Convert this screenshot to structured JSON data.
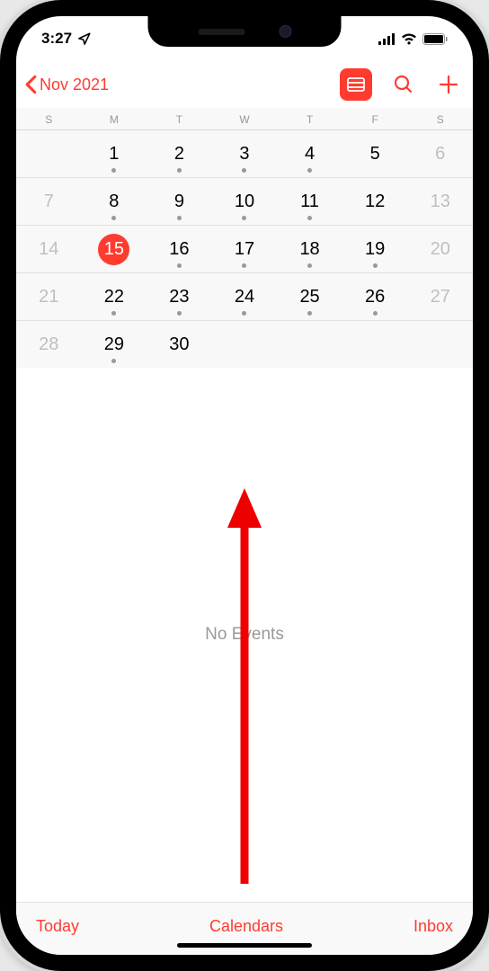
{
  "status_bar": {
    "time": "3:27"
  },
  "nav": {
    "back_label": "Nov 2021"
  },
  "weekdays": [
    "S",
    "M",
    "T",
    "W",
    "T",
    "F",
    "S"
  ],
  "calendar": {
    "weeks": [
      [
        {
          "label": "",
          "muted": false,
          "dot": false,
          "selected": false
        },
        {
          "label": "1",
          "muted": false,
          "dot": true,
          "selected": false
        },
        {
          "label": "2",
          "muted": false,
          "dot": true,
          "selected": false
        },
        {
          "label": "3",
          "muted": false,
          "dot": true,
          "selected": false
        },
        {
          "label": "4",
          "muted": false,
          "dot": true,
          "selected": false
        },
        {
          "label": "5",
          "muted": false,
          "dot": false,
          "selected": false
        },
        {
          "label": "6",
          "muted": true,
          "dot": false,
          "selected": false
        }
      ],
      [
        {
          "label": "7",
          "muted": true,
          "dot": false,
          "selected": false
        },
        {
          "label": "8",
          "muted": false,
          "dot": true,
          "selected": false
        },
        {
          "label": "9",
          "muted": false,
          "dot": true,
          "selected": false
        },
        {
          "label": "10",
          "muted": false,
          "dot": true,
          "selected": false
        },
        {
          "label": "11",
          "muted": false,
          "dot": true,
          "selected": false
        },
        {
          "label": "12",
          "muted": false,
          "dot": false,
          "selected": false
        },
        {
          "label": "13",
          "muted": true,
          "dot": false,
          "selected": false
        }
      ],
      [
        {
          "label": "14",
          "muted": true,
          "dot": false,
          "selected": false
        },
        {
          "label": "15",
          "muted": false,
          "dot": false,
          "selected": true
        },
        {
          "label": "16",
          "muted": false,
          "dot": true,
          "selected": false
        },
        {
          "label": "17",
          "muted": false,
          "dot": true,
          "selected": false
        },
        {
          "label": "18",
          "muted": false,
          "dot": true,
          "selected": false
        },
        {
          "label": "19",
          "muted": false,
          "dot": true,
          "selected": false
        },
        {
          "label": "20",
          "muted": true,
          "dot": false,
          "selected": false
        }
      ],
      [
        {
          "label": "21",
          "muted": true,
          "dot": false,
          "selected": false
        },
        {
          "label": "22",
          "muted": false,
          "dot": true,
          "selected": false
        },
        {
          "label": "23",
          "muted": false,
          "dot": true,
          "selected": false
        },
        {
          "label": "24",
          "muted": false,
          "dot": true,
          "selected": false
        },
        {
          "label": "25",
          "muted": false,
          "dot": true,
          "selected": false
        },
        {
          "label": "26",
          "muted": false,
          "dot": true,
          "selected": false
        },
        {
          "label": "27",
          "muted": true,
          "dot": false,
          "selected": false
        }
      ],
      [
        {
          "label": "28",
          "muted": true,
          "dot": false,
          "selected": false
        },
        {
          "label": "29",
          "muted": false,
          "dot": true,
          "selected": false
        },
        {
          "label": "30",
          "muted": false,
          "dot": false,
          "selected": false
        },
        {
          "label": "",
          "muted": false,
          "dot": false,
          "selected": false
        },
        {
          "label": "",
          "muted": false,
          "dot": false,
          "selected": false
        },
        {
          "label": "",
          "muted": false,
          "dot": false,
          "selected": false
        },
        {
          "label": "",
          "muted": false,
          "dot": false,
          "selected": false
        }
      ]
    ]
  },
  "events": {
    "empty_label": "No Events"
  },
  "toolbar": {
    "today": "Today",
    "calendars": "Calendars",
    "inbox": "Inbox"
  },
  "colors": {
    "accent": "#ff3b30"
  }
}
